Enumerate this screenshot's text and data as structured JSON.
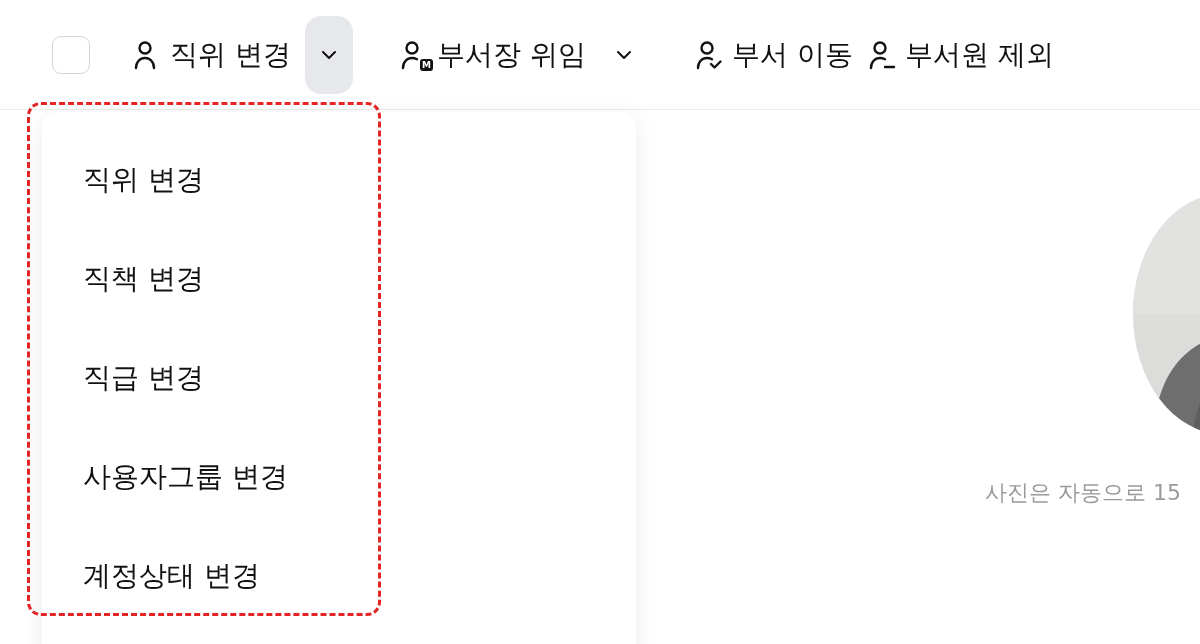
{
  "toolbar": {
    "select_all": {
      "checked": false
    },
    "actions": [
      {
        "label": "직위 변경",
        "kind": "person",
        "dropdown": {
          "expanded": true
        }
      },
      {
        "label": "부서장 위임",
        "kind": "manager",
        "badge": "M",
        "dropdown": {
          "expanded": false
        }
      },
      {
        "label": "부서 이동",
        "kind": "move"
      },
      {
        "label": "부서원 제외",
        "kind": "remove"
      }
    ]
  },
  "dropdown_menu": {
    "items": [
      {
        "label": "직위 변경"
      },
      {
        "label": "직책 변경"
      },
      {
        "label": "직급 변경"
      },
      {
        "label": "사용자그룹 변경"
      },
      {
        "label": "계정상태 변경"
      }
    ],
    "highlighted": true
  },
  "profile": {
    "caption": "사진은 자동으로 15"
  }
}
